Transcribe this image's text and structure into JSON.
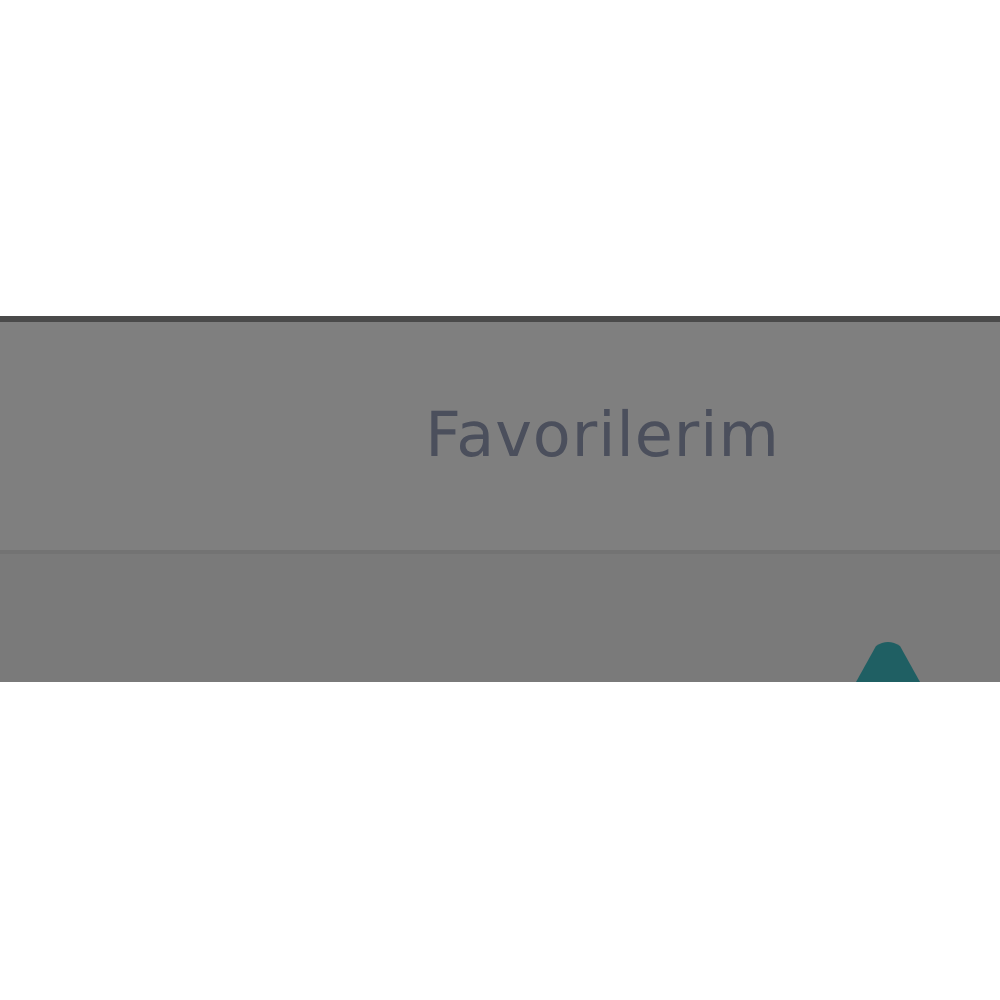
{
  "header": {
    "title": "Favorilerim"
  }
}
